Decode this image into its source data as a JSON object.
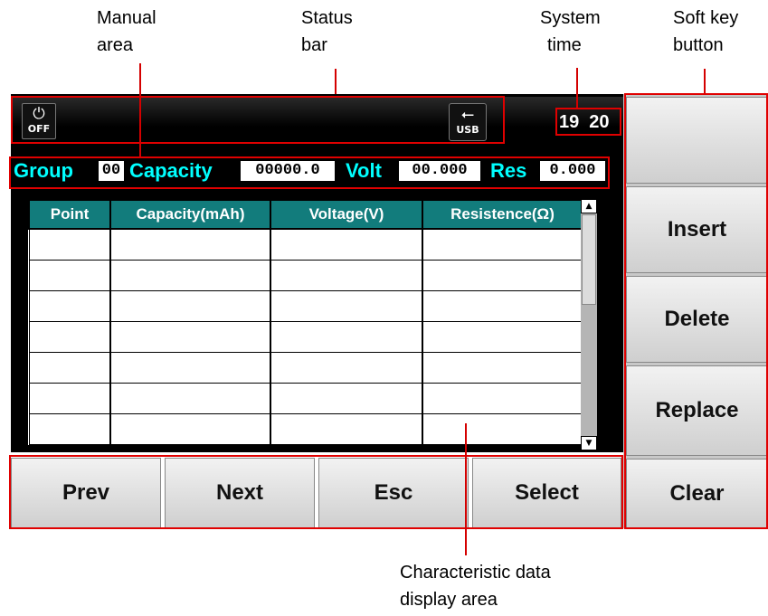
{
  "callouts": {
    "manual": [
      "Manual",
      "area"
    ],
    "status": [
      "Status",
      "bar"
    ],
    "time": [
      "System",
      "time"
    ],
    "softkey": [
      "Soft key",
      "button"
    ],
    "chardata": [
      "Characteristic data",
      "display area"
    ]
  },
  "status_bar": {
    "power_label": "OFF",
    "usb_label": "USB",
    "time_hour": "19",
    "time_minute": "20"
  },
  "params": {
    "group_label": "Group",
    "group_value": "00",
    "capacity_label": "Capacity",
    "capacity_value": "00000.0",
    "volt_label": "Volt",
    "volt_value": "00.000",
    "res_label": "Res",
    "res_value": "0.000"
  },
  "table": {
    "headers": [
      "Point",
      "Capacity(mAh)",
      "Voltage(V)",
      "Resistence(Ω)"
    ]
  },
  "bottom_buttons": [
    "Prev",
    "Next",
    "Esc",
    "Select"
  ],
  "soft_keys": [
    "",
    "Insert",
    "Delete",
    "Replace",
    "Clear"
  ],
  "colors": {
    "accent_cyan": "#00ffff",
    "header_teal": "#127c7c",
    "callout_red": "#e00000"
  }
}
